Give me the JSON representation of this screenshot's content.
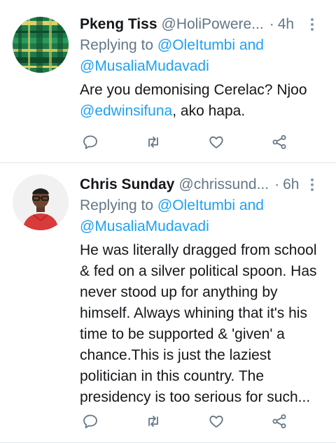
{
  "tweets": [
    {
      "name": "Pkeng Tiss",
      "handle": "@HoliPowere...",
      "time": "4h",
      "replying_prefix": "Replying to ",
      "replying_to": [
        "@OleItumbi",
        "@MusaliaMudavadi"
      ],
      "replying_joiner": " and",
      "text_before": "Are you demonising Cerelac? Njoo ",
      "text_mention": "@edwinsifuna",
      "text_after": ", ako hapa."
    },
    {
      "name": "Chris Sunday",
      "handle": "@chrissund...",
      "time": "6h",
      "replying_prefix": "Replying to ",
      "replying_to": [
        "@OleItumbi",
        "@MusaliaMudavadi"
      ],
      "replying_joiner": " and",
      "text": "He was literally dragged from school & fed on a silver political spoon. Has never stood up for anything by himself. Always whining that it's his time to be supported & 'given' a chance.This is just the laziest politician in this country. The presidency is too serious for such..."
    }
  ],
  "icons": {
    "reply": "reply-icon",
    "retweet": "retweet-icon",
    "like": "heart-icon",
    "share": "share-icon",
    "more": "more-vertical-icon"
  },
  "colors": {
    "primary_text": "#14171a",
    "secondary_text": "#657786",
    "mention": "#1da1f2",
    "icon": "#657786",
    "divider": "#e1e8ed"
  }
}
